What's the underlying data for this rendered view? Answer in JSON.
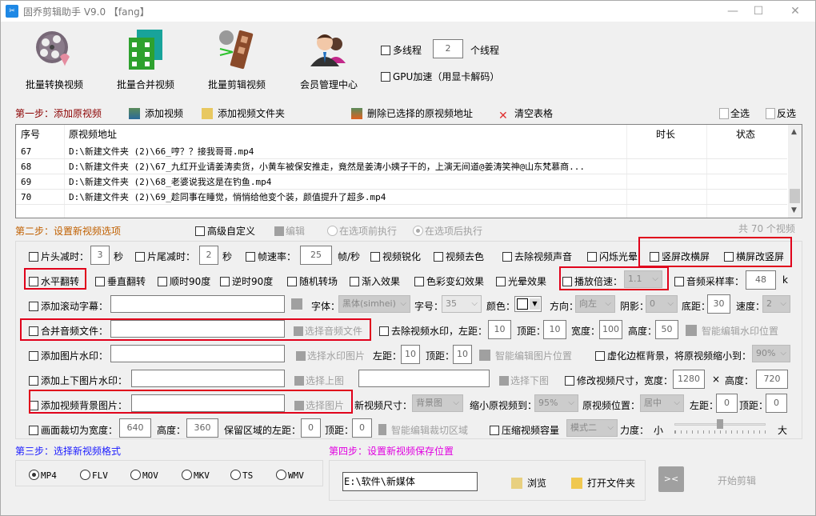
{
  "window": {
    "title": "固乔剪辑助手 V9.0  【fang】",
    "app_icon": "scissors-logo-icon",
    "controls": {
      "minimize": "—",
      "maximize": "☐",
      "close": "✕"
    }
  },
  "toolbar": {
    "buttons": [
      {
        "label": "批量转换视频",
        "icon": "film-reel-convert-icon"
      },
      {
        "label": "批量合并视频",
        "icon": "film-merge-icon"
      },
      {
        "label": "批量剪辑视频",
        "icon": "film-cut-icon"
      },
      {
        "label": "会员管理中心",
        "icon": "users-icon"
      }
    ],
    "multithread_label": "多线程",
    "multithread_count": "2",
    "thread_unit": "个线程",
    "gpu_label": "GPU加速（用显卡解码）"
  },
  "step1": {
    "title": "第一步：添加原视频",
    "add_video": "添加视频",
    "add_folder": "添加视频文件夹",
    "delete_selected": "删除已选择的原视频地址",
    "clear_table": "清空表格",
    "select_all": "全选",
    "invert_select": "反选",
    "columns": [
      "序号",
      "原视频地址",
      "时长",
      "状态"
    ],
    "rows": [
      {
        "index": "67",
        "path": "D:\\新建文件夹 (2)\\66_哼？？接我哥哥.mp4",
        "duration": "",
        "status": ""
      },
      {
        "index": "68",
        "path": "D:\\新建文件夹 (2)\\67_九红开业请姜涛卖货，小黄车被保安推走，竟然是姜涛小姨子干的，上演无间道@姜涛笑神@山东梵慕商...",
        "duration": "",
        "status": ""
      },
      {
        "index": "69",
        "path": "D:\\新建文件夹 (2)\\68_老婆说我这是在钓鱼.mp4",
        "duration": "",
        "status": ""
      },
      {
        "index": "70",
        "path": "D:\\新建文件夹 (2)\\69_趁同事在睡觉，悄悄给他变个装，颜值提升了超多.mp4",
        "duration": "",
        "status": ""
      }
    ],
    "total": "共 70 个视频"
  },
  "step2": {
    "title": "第二步：设置新视频选项",
    "advanced": "高级自定义",
    "edit": "编辑",
    "before": "在选项前执行",
    "after": "在选项后执行",
    "row1": {
      "head_cut": "片头减时：",
      "head_val": "3",
      "sec1": "秒",
      "tail_cut": "片尾减时：",
      "tail_val": "2",
      "sec2": "秒",
      "fps": "帧速率：",
      "fps_val": "25",
      "fps_unit": "帧/秒",
      "sharpen": "视频锐化",
      "decolor": "视频去色",
      "mute": "去除视频声音",
      "flash": "闪烁光晕",
      "v2h": "竖屏改横屏",
      "h2v": "横屏改竖屏"
    },
    "row2": {
      "hflip": "水平翻转",
      "vflip": "垂直翻转",
      "cw90": "顺时90度",
      "ccw90": "逆时90度",
      "random_trans": "随机转场",
      "fade_in": "渐入效果",
      "color_fx": "色彩变幻效果",
      "halo": "光晕效果",
      "speed": "播放倍速：",
      "speed_val": "1.1",
      "sample_rate": "音频采样率：",
      "sample_val": "48",
      "sample_unit": "k"
    },
    "row3": {
      "scroll_text": "添加滚动字幕：",
      "font": "字体：",
      "font_val": "黑体(simhei)",
      "size": "字号：",
      "size_val": "35",
      "color": "颜色：",
      "direction": "方向：",
      "direction_val": "向左",
      "shadow": "阴影：",
      "shadow_val": "0",
      "bottom": "底距：",
      "bottom_val": "30",
      "speed": "速度：",
      "speed_val": "2"
    },
    "row4": {
      "merge_audio": "合并音频文件：",
      "choose_audio": "选择音频文件",
      "remove_wm": "去除视频水印，左距：",
      "left_val": "10",
      "top": "顶距：",
      "top_val": "10",
      "width": "宽度：",
      "width_val": "100",
      "height": "高度：",
      "height_val": "50",
      "smart_wm": "智能编辑水印位置"
    },
    "row5": {
      "img_wm": "添加图片水印：",
      "choose_wm": "选择水印图片",
      "left": "左距：",
      "left_val": "10",
      "top": "顶距：",
      "top_val": "10",
      "smart_img": "智能编辑图片位置",
      "blur_bg": "虚化边框背景，将原视频缩小到：",
      "blur_val": "90%"
    },
    "row6": {
      "tb_wm": "添加上下图片水印：",
      "choose_top": "选择上图",
      "choose_bottom": "选择下图",
      "resize": "修改视频尺寸，宽度：",
      "w_val": "1280",
      "x": "×",
      "h": "高度：",
      "h_val": "720"
    },
    "row7": {
      "bg_img": "添加视频背景图片：",
      "choose_img": "选择图片",
      "new_size": "新视频尺寸：",
      "new_size_val": "背景图",
      "shrink": "缩小原视频到：",
      "shrink_val": "95%",
      "pos": "原视频位置：",
      "pos_val": "居中",
      "left": "左距：",
      "left_val": "0",
      "top": "顶距：",
      "top_val": "0"
    },
    "row8": {
      "crop": "画面裁切为宽度：",
      "crop_w": "640",
      "crop_h_label": "高度：",
      "crop_h": "360",
      "keep_left": "保留区域的左距：",
      "keep_left_val": "0",
      "keep_top": "顶距：",
      "keep_top_val": "0",
      "smart_crop": "智能编辑裁切区域",
      "compress": "压缩视频容量",
      "mode_val": "模式二",
      "strength": "力度：",
      "small": "小",
      "large": "大",
      "strength_level": 0.5
    }
  },
  "step3": {
    "title": "第三步：选择新视频格式",
    "formats": [
      "MP4",
      "FLV",
      "MOV",
      "MKV",
      "TS",
      "WMV"
    ],
    "selected": "MP4"
  },
  "step4": {
    "title": "第四步：设置新视频保存位置",
    "path": "E:\\软件\\新媒体",
    "browse": "浏览",
    "open_folder": "打开文件夹",
    "start": "开始剪辑"
  },
  "colors": {
    "step1": "#8b0000",
    "step2": "#c06000",
    "step3": "#1a1aff",
    "step4": "#e000e0",
    "highlight": "#e0001b"
  }
}
